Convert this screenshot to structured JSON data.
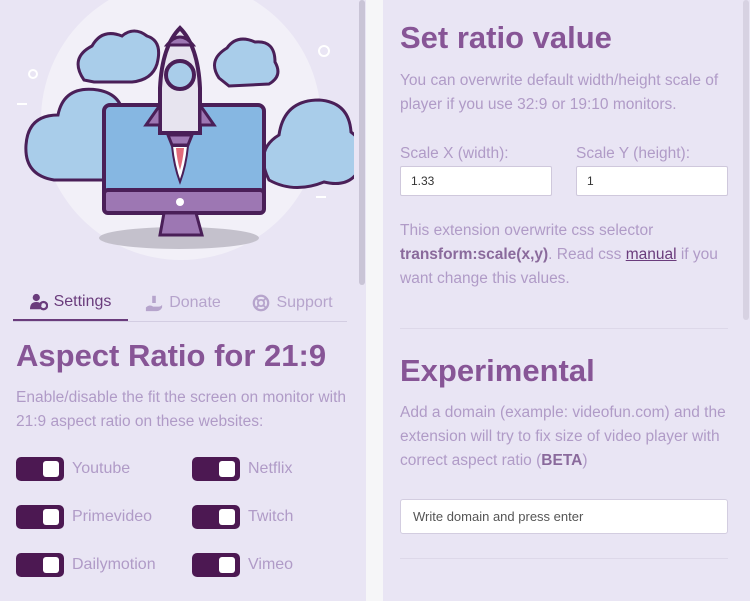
{
  "colors": {
    "panel_bg": "#e9e5f4",
    "accent": "#875596",
    "text_muted": "#b09bc7",
    "toggle_on": "#4c1852"
  },
  "hero": {
    "icon": "rocket-monitor-clouds-illustration"
  },
  "tabs": [
    {
      "label": "Settings",
      "icon": "users-cog-icon",
      "active": true
    },
    {
      "label": "Donate",
      "icon": "hand-holding-icon",
      "active": false
    },
    {
      "label": "Support",
      "icon": "life-ring-icon",
      "active": false
    }
  ],
  "settings": {
    "title": "Aspect Ratio for 21:9",
    "description": "Enable/disable the fit the screen on monitor with 21:9 aspect ratio on these websites:",
    "sites": [
      {
        "label": "Youtube",
        "enabled": true
      },
      {
        "label": "Netflix",
        "enabled": true
      },
      {
        "label": "Primevideo",
        "enabled": true
      },
      {
        "label": "Twitch",
        "enabled": true
      },
      {
        "label": "Dailymotion",
        "enabled": true
      },
      {
        "label": "Vimeo",
        "enabled": true
      }
    ]
  },
  "ratio": {
    "title": "Set ratio value",
    "description": "You can overwrite default width/height scale of player if you use 32:9 or 19:10 monitors.",
    "scale_x_label": "Scale X (width):",
    "scale_x_value": "1.33",
    "scale_y_label": "Scale Y (height):",
    "scale_y_value": "1",
    "note_prefix": "This extension overwrite css selector ",
    "note_selector": "transform:scale(x,y)",
    "note_middle": ". Read css ",
    "note_link": "manual",
    "note_suffix": " if you want change this values."
  },
  "experimental": {
    "title": "Experimental",
    "description_prefix": "Add a domain (example: videofun.com) and the extension will try to fix size of video player with correct aspect ratio (",
    "description_bold": "BETA",
    "description_suffix": ")",
    "input_placeholder": "Write domain and press enter"
  }
}
